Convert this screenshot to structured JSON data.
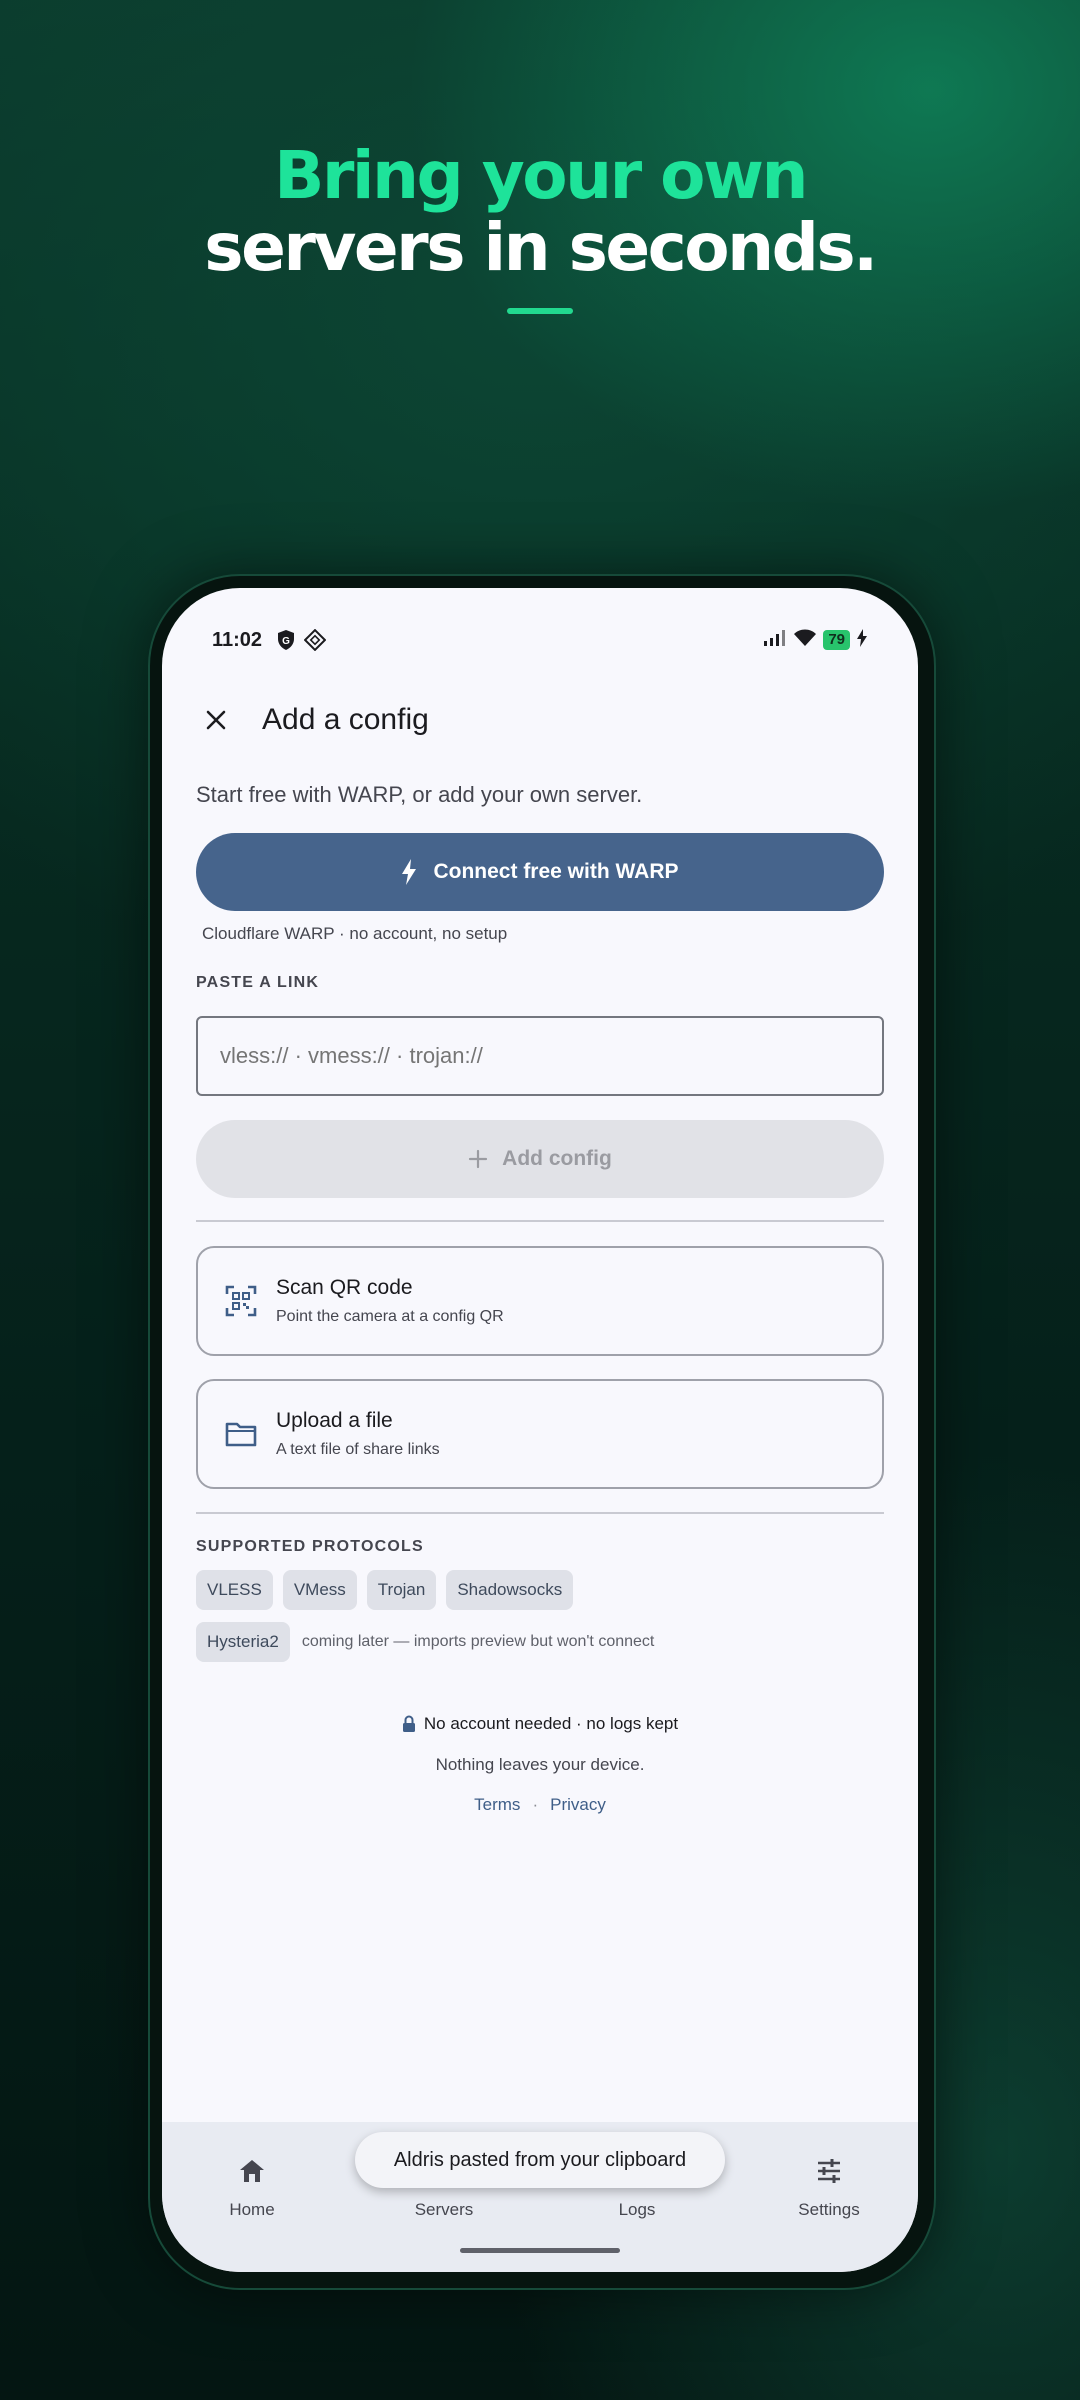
{
  "hero": {
    "line1": "Bring your own",
    "line2": "servers in seconds."
  },
  "status_bar": {
    "time": "11:02",
    "battery": "79"
  },
  "top_bar": {
    "title": "Add a config"
  },
  "intro": "Start free with WARP, or add your own server.",
  "warp": {
    "button_label": "Connect free with WARP",
    "caption": "Cloudflare WARP · no account, no setup"
  },
  "paste": {
    "section_label": "PASTE A LINK",
    "placeholder": "vless:// · vmess:// · trojan://",
    "value": "",
    "add_button_label": "Add config"
  },
  "options": [
    {
      "title": "Scan QR code",
      "subtitle": "Point the camera at a config QR",
      "icon": "qr-scan-icon"
    },
    {
      "title": "Upload a file",
      "subtitle": "A text file of share links",
      "icon": "folder-icon"
    }
  ],
  "protocols": {
    "section_label": "SUPPORTED PROTOCOLS",
    "supported": [
      "VLESS",
      "VMess",
      "Trojan",
      "Shadowsocks"
    ],
    "coming_later": "Hysteria2",
    "coming_later_note": "coming later — imports preview but won't connect"
  },
  "footer": {
    "privacy_line": "No account needed · no logs kept",
    "device_line": "Nothing leaves your device.",
    "terms_link": "Terms",
    "separator": "·",
    "privacy_link": "Privacy"
  },
  "bottom_nav": {
    "items": [
      {
        "label": "Home",
        "icon": "home-icon"
      },
      {
        "label": "Servers",
        "icon": "servers-icon"
      },
      {
        "label": "Logs",
        "icon": "logs-icon"
      },
      {
        "label": "Settings",
        "icon": "settings-icon"
      }
    ]
  },
  "toast": "Aldris pasted from your clipboard",
  "colors": {
    "hero_accent": "#1ee39a",
    "primary_button": "#46648c",
    "surface": "#f8f8fd",
    "nav_surface": "#e8ebf2"
  }
}
